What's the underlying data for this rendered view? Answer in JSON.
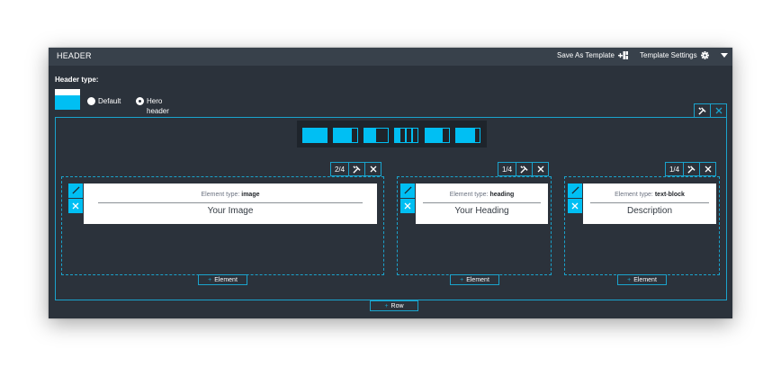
{
  "header": {
    "title": "HEADER",
    "save_template_label": "Save As Template",
    "template_settings_label": "Template Settings"
  },
  "header_type": {
    "label": "Header type:",
    "options": [
      {
        "label": "Default",
        "checked": false
      },
      {
        "label": "Hero header",
        "checked": true
      }
    ]
  },
  "columns": [
    {
      "size": "2/4",
      "element_type_prefix": "Element type:",
      "element_type": "image",
      "value": "Your Image"
    },
    {
      "size": "1/4",
      "element_type_prefix": "Element type:",
      "element_type": "heading",
      "value": "Your Heading"
    },
    {
      "size": "1/4",
      "element_type_prefix": "Element type:",
      "element_type": "text-block",
      "value": "Description"
    }
  ],
  "add_element_label": "Element",
  "add_row_label": "Row",
  "colors": {
    "accent": "#00bff3",
    "panel": "#2b323b",
    "titlebar": "#38414b"
  },
  "icons": [
    "add-template-icon",
    "gear-icon",
    "caret-down-icon",
    "wrench-icon",
    "close-icon",
    "pencil-icon",
    "plus-icon"
  ]
}
